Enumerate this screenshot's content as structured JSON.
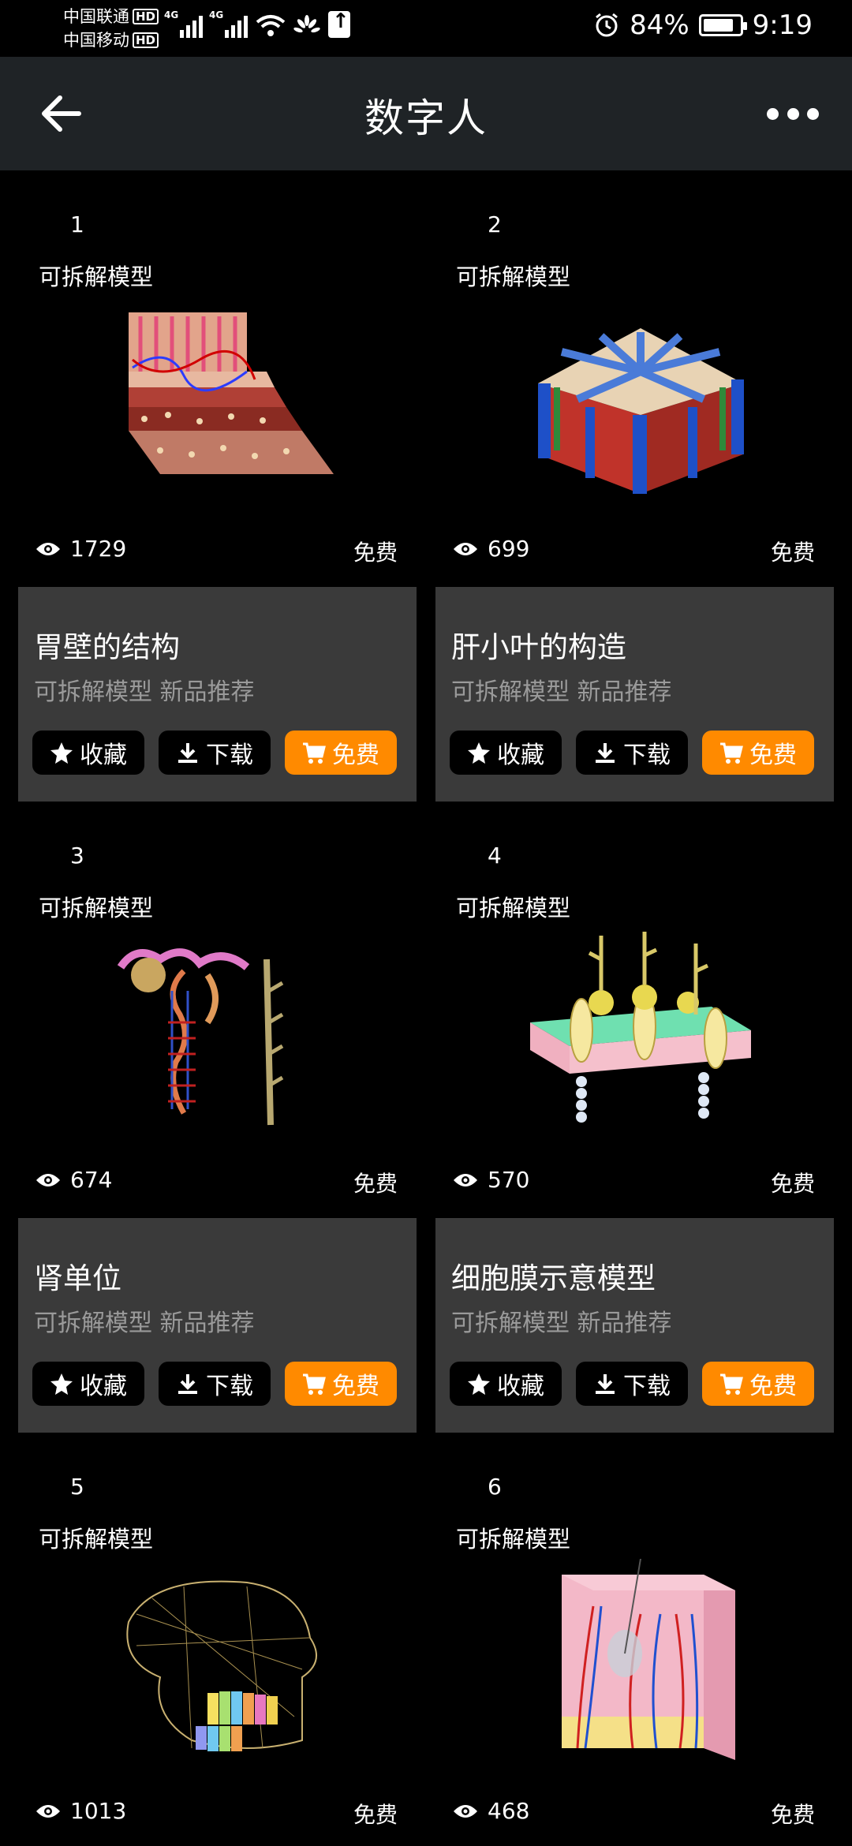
{
  "status_bar": {
    "carrier1": "中国联通",
    "carrier2": "中国移动",
    "hd": "HD",
    "net": "4G",
    "battery": "84%",
    "battery_level": 0.84,
    "time": "9:19"
  },
  "header": {
    "title": "数字人"
  },
  "cards": [
    {
      "index": "1",
      "tag": "可拆解模型",
      "views": "1729",
      "price": "免费",
      "title": "胃壁的结构",
      "subtitle": "可拆解模型 新品推荐",
      "fav": "收藏",
      "download": "下载",
      "buy": "免费"
    },
    {
      "index": "2",
      "tag": "可拆解模型",
      "views": "699",
      "price": "免费",
      "title": "肝小叶的构造",
      "subtitle": "可拆解模型 新品推荐",
      "fav": "收藏",
      "download": "下载",
      "buy": "免费"
    },
    {
      "index": "3",
      "tag": "可拆解模型",
      "views": "674",
      "price": "免费",
      "title": "肾单位",
      "subtitle": "可拆解模型 新品推荐",
      "fav": "收藏",
      "download": "下载",
      "buy": "免费"
    },
    {
      "index": "4",
      "tag": "可拆解模型",
      "views": "570",
      "price": "免费",
      "title": "细胞膜示意模型",
      "subtitle": "可拆解模型 新品推荐",
      "fav": "收藏",
      "download": "下载",
      "buy": "免费"
    },
    {
      "index": "5",
      "tag": "可拆解模型",
      "views": "1013",
      "price": "免费"
    },
    {
      "index": "6",
      "tag": "可拆解模型",
      "views": "468",
      "price": "免费"
    }
  ],
  "colors": {
    "accent": "#ff8a00",
    "panel": "#3a3a3a",
    "appbar": "#1f2326"
  }
}
